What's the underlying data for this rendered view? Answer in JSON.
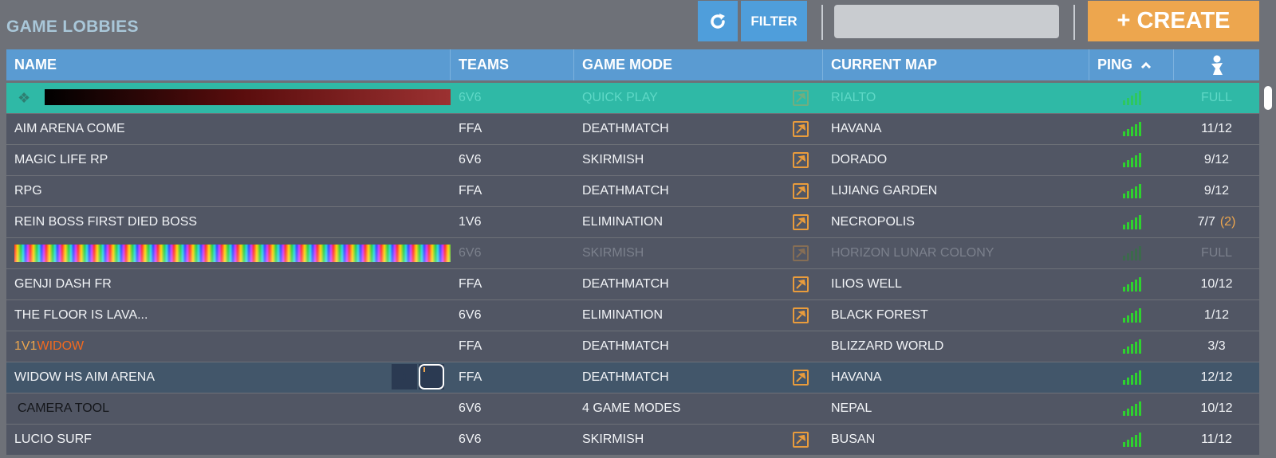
{
  "header": {
    "title": "GAME LOBBIES",
    "filter_label": "FILTER",
    "create_label": "+ CREATE",
    "search_value": "",
    "refresh_icon": "refresh-icon"
  },
  "columns": {
    "name": "NAME",
    "teams": "TEAMS",
    "mode": "GAME MODE",
    "map": "CURRENT MAP",
    "ping": "PING",
    "players_icon": "player-icon"
  },
  "colors": {
    "accent_blue": "#5a9bd2",
    "create_orange": "#eda64e",
    "row_bg": "#515664",
    "highlight_teal": "#2fb9a6",
    "ping_green": "#2ed22e"
  },
  "rows": [
    {
      "name": "",
      "teams": "6V6",
      "mode": "QUICK PLAY",
      "map": "RIALTO",
      "players": "FULL"
    },
    {
      "name": "AIM ARENA COME",
      "teams": "FFA",
      "mode": "DEATHMATCH",
      "map": "HAVANA",
      "players": "11/12"
    },
    {
      "name": "MAGIC LIFE RP",
      "teams": "6V6",
      "mode": "SKIRMISH",
      "map": "DORADO",
      "players": "9/12"
    },
    {
      "name": "RPG",
      "teams": "FFA",
      "mode": "DEATHMATCH",
      "map": "LIJIANG GARDEN",
      "players": "9/12"
    },
    {
      "name": "REIN BOSS FIRST DIED BOSS",
      "teams": "1V6",
      "mode": "ELIMINATION",
      "map": "NECROPOLIS",
      "players": "7/7",
      "extra": "(2)"
    },
    {
      "name": "",
      "teams": "6V6",
      "mode": "SKIRMISH",
      "map": "HORIZON LUNAR COLONY",
      "players": "FULL"
    },
    {
      "name": "GENJI DASH FR",
      "teams": "FFA",
      "mode": "DEATHMATCH",
      "map": "ILIOS WELL",
      "players": "10/12"
    },
    {
      "name": "THE FLOOR IS LAVA...",
      "teams": "6V6",
      "mode": "ELIMINATION",
      "map": "BLACK FOREST",
      "players": "1/12"
    },
    {
      "name_part1": "1V1",
      "name_part2": "WIDOW",
      "teams": "FFA",
      "mode": "DEATHMATCH",
      "map": "BLIZZARD WORLD",
      "players": "3/3"
    },
    {
      "name": "WIDOW HS AIM ARENA",
      "teams": "FFA",
      "mode": "DEATHMATCH",
      "map": "HAVANA",
      "players": "12/12"
    },
    {
      "name": "CAMERA TOOL",
      "teams": "6V6",
      "mode": "4 GAME MODES",
      "map": "NEPAL",
      "players": "10/12"
    },
    {
      "name": "LUCIO SURF",
      "teams": "6V6",
      "mode": "SKIRMISH",
      "map": "BUSAN",
      "players": "11/12"
    }
  ]
}
